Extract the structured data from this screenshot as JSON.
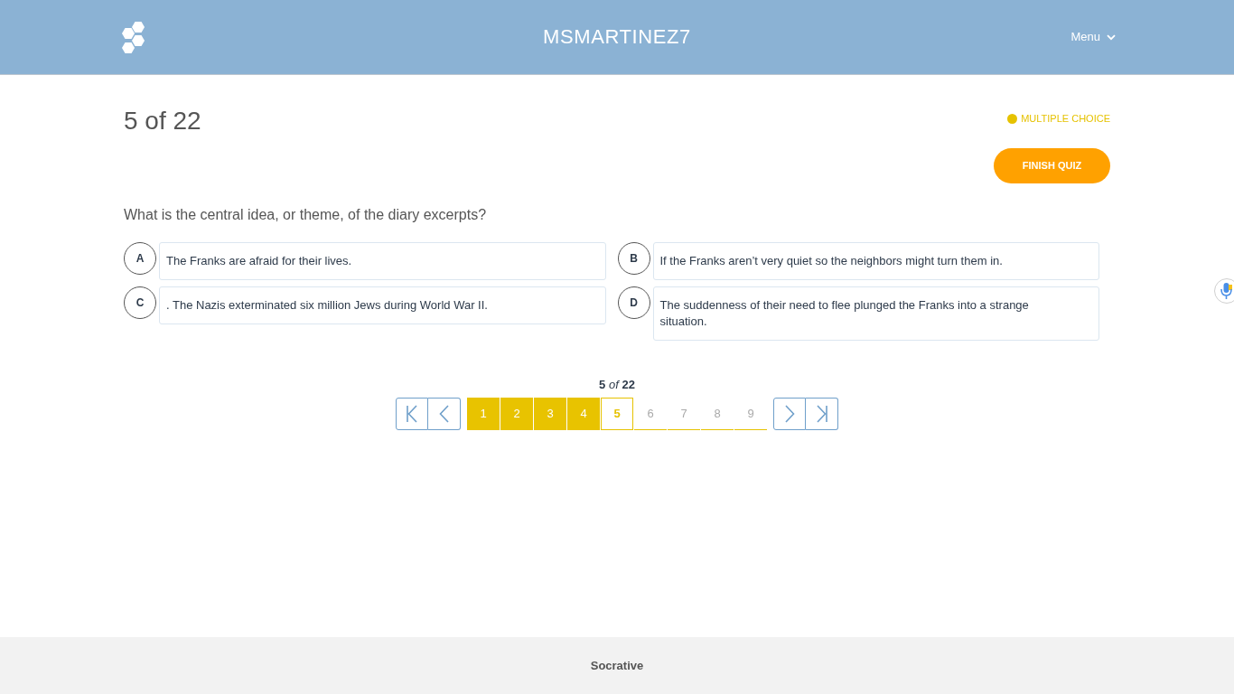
{
  "header": {
    "title": "MSMARTINEZ7",
    "menu_label": "Menu"
  },
  "quiz": {
    "progress": "5 of 22",
    "question_type": "MULTIPLE CHOICE",
    "finish_button": "FINISH QUIZ"
  },
  "question": "What is the central idea, or theme, of the diary excerpts?",
  "answers": [
    {
      "letter": "A",
      "text": "The Franks are afraid for their lives.",
      "selected": false
    },
    {
      "letter": "B",
      "text": "If the Franks aren’t very quiet so the neighbors might turn them in.",
      "selected": false
    },
    {
      "letter": "C",
      "text": ". The Nazis exterminated six million Jews during World War II.",
      "selected": false
    },
    {
      "letter": "D",
      "text": "The suddenness of their need to flee plunged the Franks into a strange situation.",
      "selected": false
    }
  ],
  "pagination": {
    "counter": "**5** *of* **22**",
    "pages": [
      {
        "label": "1",
        "answered": true,
        "selected": false
      },
      {
        "label": "2",
        "answered": true,
        "selected": false
      },
      {
        "label": "3",
        "answered": true,
        "selected": false
      },
      {
        "label": "4",
        "answered": true,
        "selected": false
      },
      {
        "label": "5",
        "answered": false,
        "selected": true
      },
      {
        "label": "6",
        "answered": false,
        "selected": false
      },
      {
        "label": "7",
        "answered": false,
        "selected": false
      },
      {
        "label": "8",
        "answered": false,
        "selected": false
      },
      {
        "label": "9",
        "answered": false,
        "selected": false
      }
    ]
  },
  "footer": {
    "text": "Socrative"
  }
}
